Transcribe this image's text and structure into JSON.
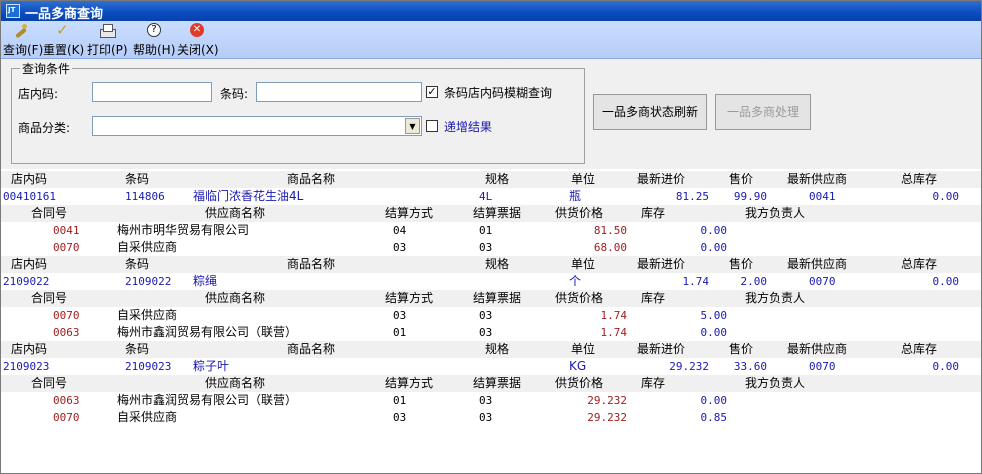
{
  "window": {
    "title": "一品多商查询"
  },
  "toolbar": {
    "query": "查询(F)",
    "reset": "重置(K)",
    "print": "打印(P)",
    "help": "帮助(H)",
    "close": "关闭(X)"
  },
  "conditions": {
    "title": "查询条件",
    "store_code_label": "店内码:",
    "barcode_label": "条码:",
    "category_label": "商品分类:",
    "fuzzy_label": "条码店内码模糊查询",
    "fuzzy_checked": "✓",
    "increment_label": "递增结果"
  },
  "buttons": {
    "refresh": "一品多商状态刷新",
    "process": "一品多商处理"
  },
  "header": {
    "c1": "店内码",
    "c2": "条码",
    "c3": "商品名称",
    "c4": "规格",
    "c5": "单位",
    "c6": "最新进价",
    "c7": "售价",
    "c8": "最新供应商",
    "c9": "总库存"
  },
  "subheader": {
    "s1": "合同号",
    "s2": "供应商名称",
    "s3": "结算方式",
    "s4": "结算票据",
    "s5": "供货价格",
    "s6": "库存",
    "s7": "我方负责人"
  },
  "items": [
    {
      "code": "00410161",
      "barcode": "114806",
      "name": "福临门浓香花生油4L",
      "spec": "4L",
      "unit": "瓶",
      "cost": "81.25",
      "price": "99.90",
      "supplier": "0041",
      "stock": "0.00",
      "subs": [
        {
          "contract": "0041",
          "vendor": "梅州市明华贸易有限公司",
          "settle": "04",
          "bill": "01",
          "supply": "81.50",
          "inv": "0.00"
        },
        {
          "contract": "0070",
          "vendor": "自采供应商",
          "settle": "03",
          "bill": "03",
          "supply": "68.00",
          "inv": "0.00"
        }
      ]
    },
    {
      "code": "2109022",
      "barcode": "2109022",
      "name": "粽绳",
      "spec": "",
      "unit": "个",
      "cost": "1.74",
      "price": "2.00",
      "supplier": "0070",
      "stock": "0.00",
      "subs": [
        {
          "contract": "0070",
          "vendor": "自采供应商",
          "settle": "03",
          "bill": "03",
          "supply": "1.74",
          "inv": "5.00"
        },
        {
          "contract": "0063",
          "vendor": "梅州市鑫润贸易有限公司（联营）",
          "settle": "01",
          "bill": "03",
          "supply": "1.74",
          "inv": "0.00"
        }
      ]
    },
    {
      "code": "2109023",
      "barcode": "2109023",
      "name": "粽子叶",
      "spec": "",
      "unit": "KG",
      "cost": "29.232",
      "price": "33.60",
      "supplier": "0070",
      "stock": "0.00",
      "subs": [
        {
          "contract": "0063",
          "vendor": "梅州市鑫润贸易有限公司（联营）",
          "settle": "01",
          "bill": "03",
          "supply": "29.232",
          "inv": "0.00"
        },
        {
          "contract": "0070",
          "vendor": "自采供应商",
          "settle": "03",
          "bill": "03",
          "supply": "29.232",
          "inv": "0.85"
        }
      ]
    }
  ]
}
